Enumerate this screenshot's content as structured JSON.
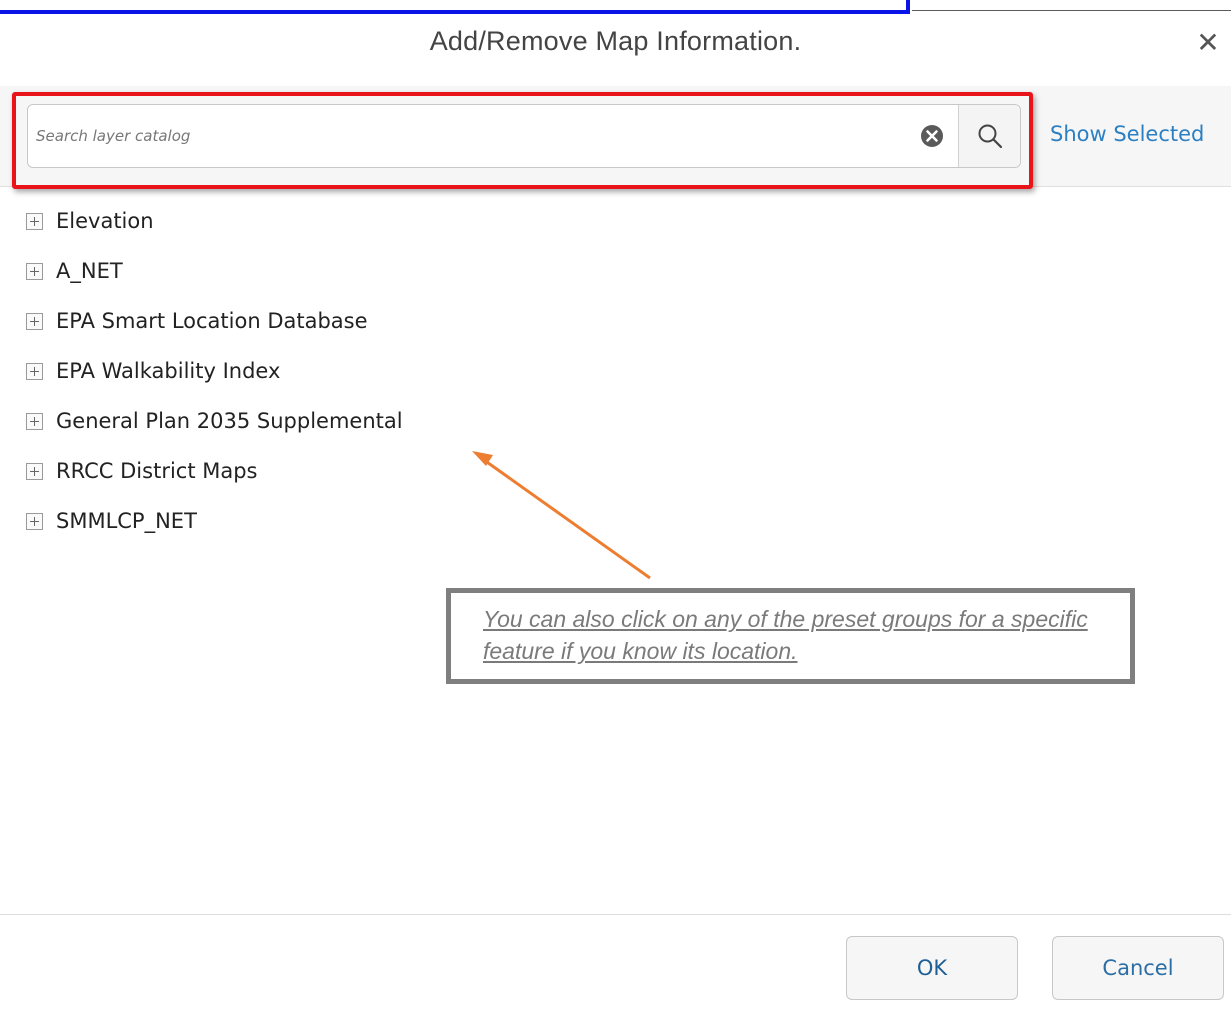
{
  "dialog": {
    "title": "Add/Remove Map Information.",
    "close_icon": "close-icon"
  },
  "search": {
    "placeholder": "Search layer catalog",
    "value": "",
    "clear_icon": "clear-circle-x-icon",
    "search_icon": "magnifier-icon",
    "show_selected_label": "Show Selected"
  },
  "catalog": {
    "items": [
      {
        "label": "Elevation",
        "icon": "expand-plus-icon"
      },
      {
        "label": "A_NET",
        "icon": "expand-plus-icon"
      },
      {
        "label": "EPA Smart Location Database",
        "icon": "expand-plus-icon"
      },
      {
        "label": "EPA Walkability Index",
        "icon": "expand-plus-icon"
      },
      {
        "label": "General Plan 2035 Supplemental",
        "icon": "expand-plus-icon"
      },
      {
        "label": "RRCC District Maps",
        "icon": "expand-plus-icon"
      },
      {
        "label": "SMMLCP_NET",
        "icon": "expand-plus-icon"
      }
    ]
  },
  "annotation": {
    "callout_text": "You can also click on any of the preset groups for a specific feature if you know its location.",
    "arrow_color": "#ed7d31",
    "search_highlight_color": "#e8141a",
    "top_frame_color": "#0a14e6"
  },
  "footer": {
    "ok_label": "OK",
    "cancel_label": "Cancel"
  }
}
